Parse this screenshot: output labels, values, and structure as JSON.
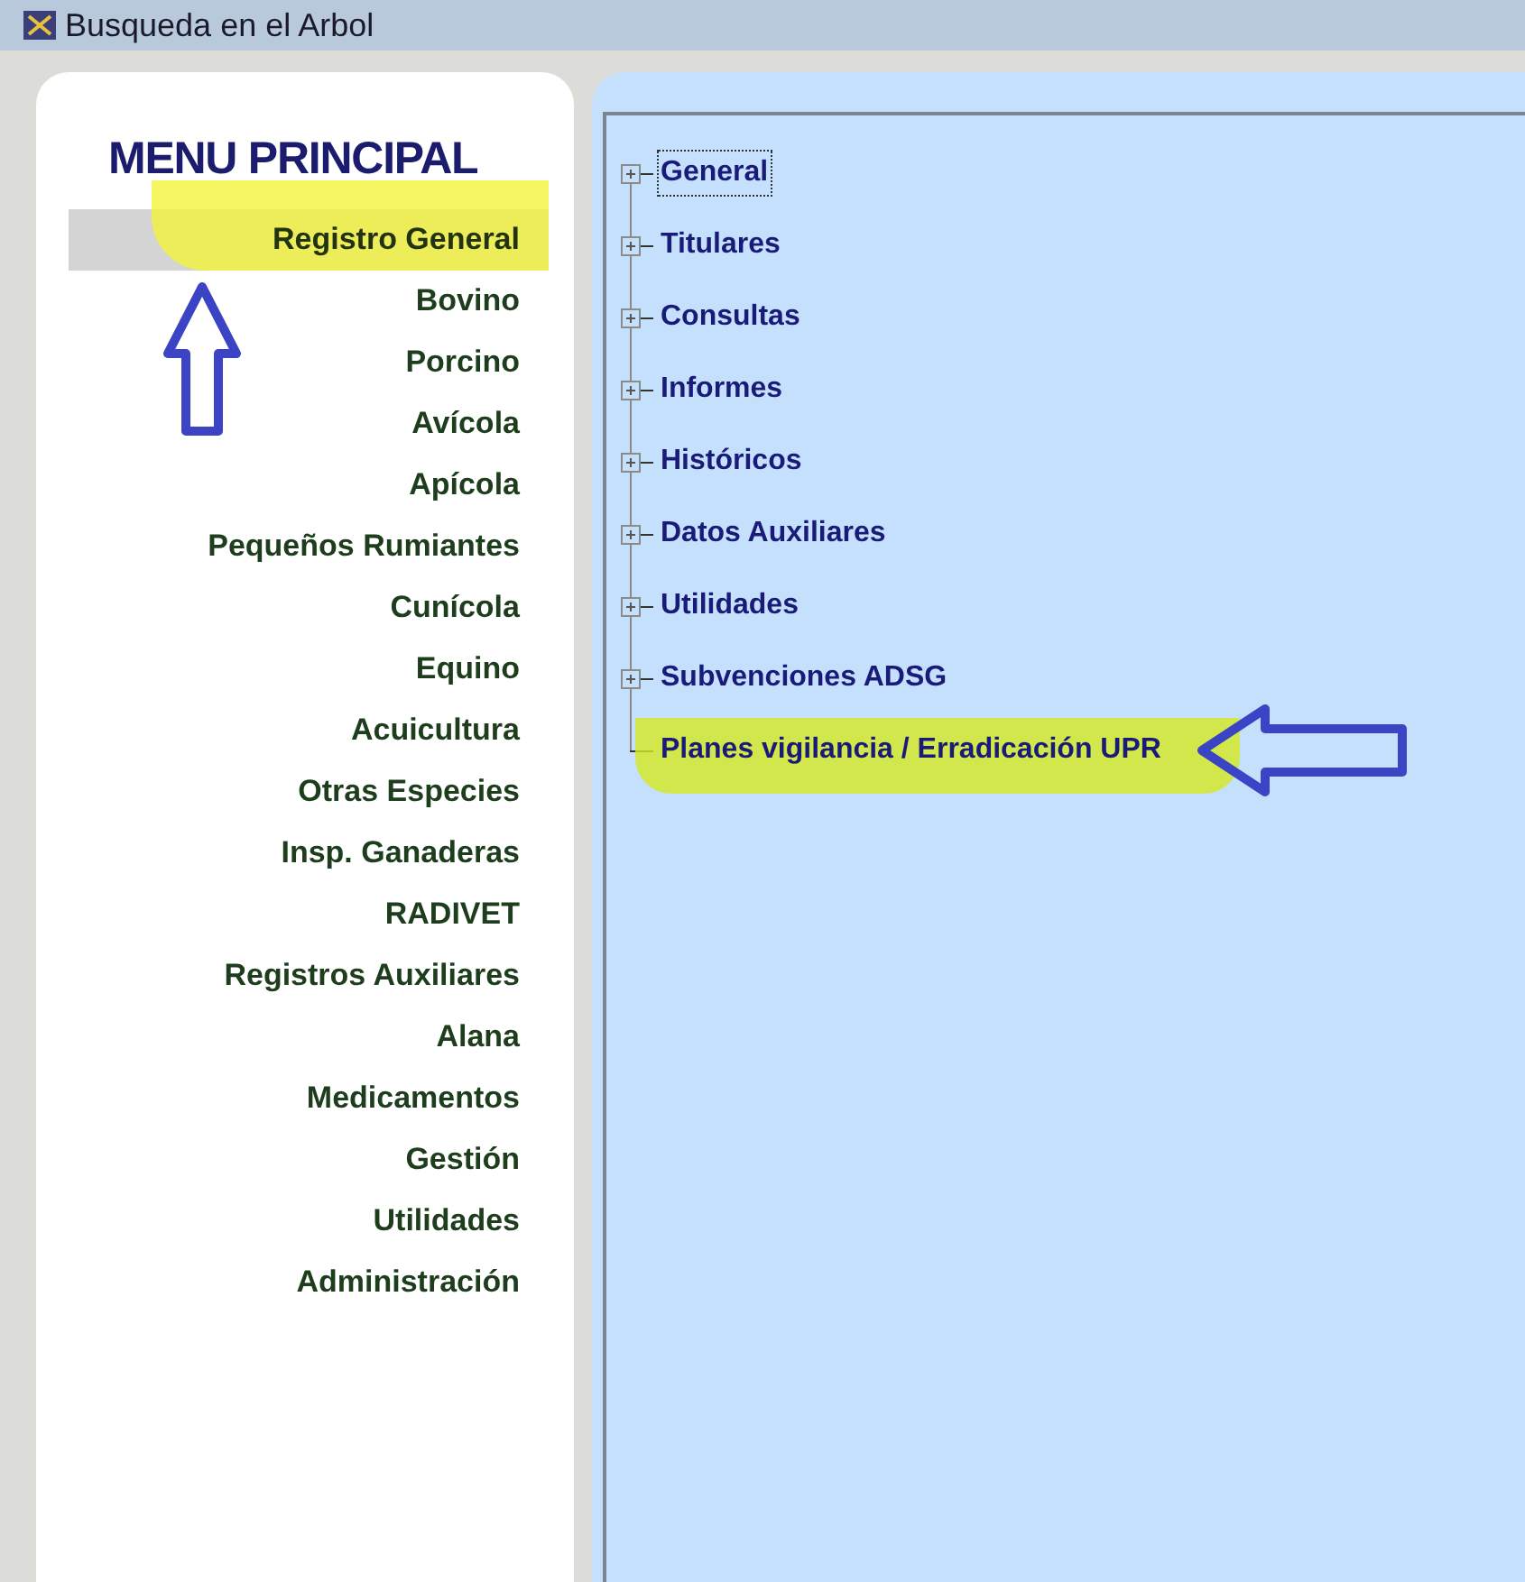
{
  "window": {
    "title": "Busqueda en el Arbol"
  },
  "menu": {
    "title": "MENU PRINCIPAL",
    "items": [
      {
        "label": "Registro General",
        "selected": true,
        "highlighted": true
      },
      {
        "label": "Bovino",
        "selected": false,
        "highlighted": false
      },
      {
        "label": "Porcino",
        "selected": false,
        "highlighted": false
      },
      {
        "label": "Avícola",
        "selected": false,
        "highlighted": false
      },
      {
        "label": "Apícola",
        "selected": false,
        "highlighted": false
      },
      {
        "label": "Pequeños Rumiantes",
        "selected": false,
        "highlighted": false
      },
      {
        "label": "Cunícola",
        "selected": false,
        "highlighted": false
      },
      {
        "label": "Equino",
        "selected": false,
        "highlighted": false
      },
      {
        "label": "Acuicultura",
        "selected": false,
        "highlighted": false
      },
      {
        "label": "Otras Especies",
        "selected": false,
        "highlighted": false
      },
      {
        "label": "Insp. Ganaderas",
        "selected": false,
        "highlighted": false
      },
      {
        "label": "RADIVET",
        "selected": false,
        "highlighted": false
      },
      {
        "label": "Registros Auxiliares",
        "selected": false,
        "highlighted": false
      },
      {
        "label": "Alana",
        "selected": false,
        "highlighted": false
      },
      {
        "label": "Medicamentos",
        "selected": false,
        "highlighted": false
      },
      {
        "label": "Gestión",
        "selected": false,
        "highlighted": false
      },
      {
        "label": "Utilidades",
        "selected": false,
        "highlighted": false
      },
      {
        "label": "Administración",
        "selected": false,
        "highlighted": false
      }
    ]
  },
  "tree": {
    "items": [
      {
        "label": "General",
        "expandable": true,
        "focused": true,
        "highlighted": false
      },
      {
        "label": "Titulares",
        "expandable": true,
        "focused": false,
        "highlighted": false
      },
      {
        "label": "Consultas",
        "expandable": true,
        "focused": false,
        "highlighted": false
      },
      {
        "label": "Informes",
        "expandable": true,
        "focused": false,
        "highlighted": false
      },
      {
        "label": "Históricos",
        "expandable": true,
        "focused": false,
        "highlighted": false
      },
      {
        "label": "Datos Auxiliares",
        "expandable": true,
        "focused": false,
        "highlighted": false
      },
      {
        "label": "Utilidades",
        "expandable": true,
        "focused": false,
        "highlighted": false
      },
      {
        "label": "Subvenciones ADSG",
        "expandable": true,
        "focused": false,
        "highlighted": false
      },
      {
        "label": "Planes vigilancia / Erradicación UPR",
        "expandable": false,
        "focused": false,
        "highlighted": true
      }
    ]
  }
}
